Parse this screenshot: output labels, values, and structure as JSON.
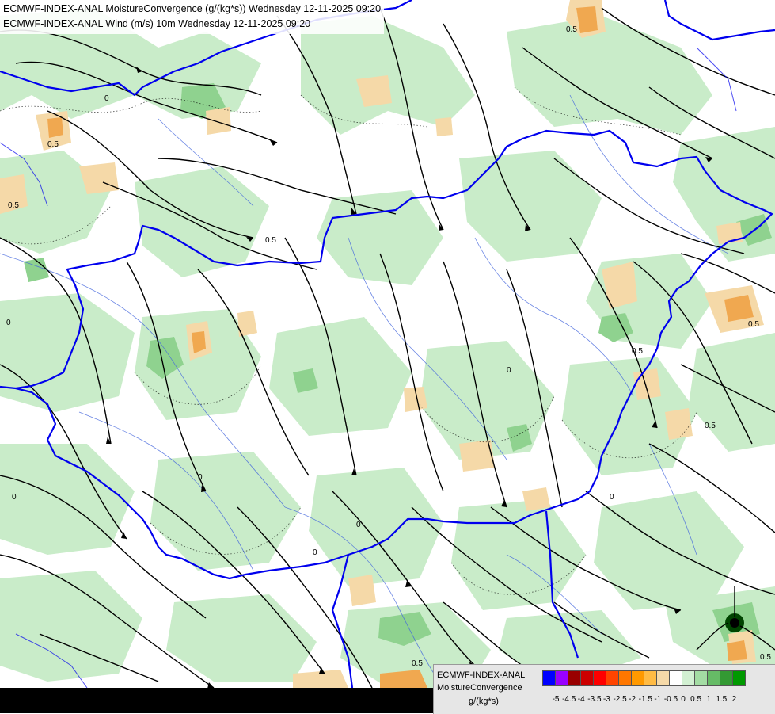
{
  "header": {
    "line1": "ECMWF-INDEX-ANAL MoistureConvergence (g/(kg*s)) Wednesday 12-11-2025 09:20",
    "line2": "ECMWF-INDEX-ANAL Wind (m/s) 10m Wednesday 12-11-2025 09:20"
  },
  "legend": {
    "model": "ECMWF-INDEX-ANAL",
    "parameter": "MoistureConvergence",
    "unit": "g/(kg*s)",
    "colors": [
      "#0000ff",
      "#9900ff",
      "#990000",
      "#cc0000",
      "#ff0000",
      "#ff4400",
      "#ff7700",
      "#ff9900",
      "#ffbb44",
      "#f5d9a8",
      "#ffffff",
      "#d2f0d2",
      "#a3dca3",
      "#66bb66",
      "#339933",
      "#009900"
    ],
    "ticks": [
      "-5",
      "-4.5",
      "-4",
      "-3.5",
      "-3",
      "-2.5",
      "-2",
      "-1.5",
      "-1",
      "-0.5",
      "0",
      "0.5",
      "1",
      "1.5",
      "2"
    ]
  },
  "map": {
    "contour_labels": [
      "0",
      "0",
      "0",
      "0",
      "0",
      "0",
      "0",
      "0",
      "0.5",
      "0.5",
      "0.5",
      "0.5",
      "0.5",
      "0.5",
      "0.5",
      "0.5",
      "0.5"
    ],
    "colors": {
      "border": "#0000ee",
      "river": "#4466dd",
      "streamline": "#000000",
      "convergence_weak": "#c8ecc8",
      "convergence_mid": "#7fcc7f",
      "divergence_weak": "#f5d9a8",
      "divergence_mid": "#f0b060"
    }
  }
}
